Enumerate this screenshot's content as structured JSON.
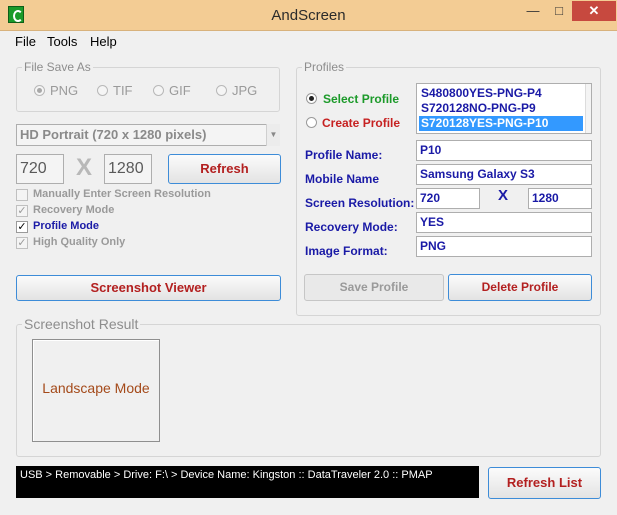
{
  "window": {
    "title": "AndScreen"
  },
  "menu": {
    "items": [
      "File",
      "Tools",
      "Help"
    ]
  },
  "file_save": {
    "label": "File Save As",
    "formats": [
      "PNG",
      "TIF",
      "GIF",
      "JPG"
    ],
    "selected": "PNG"
  },
  "resolution": {
    "preset": "HD Portrait (720 x 1280 pixels)",
    "width": "720",
    "x_sep": "X",
    "height": "1280",
    "refresh_label": "Refresh"
  },
  "options": {
    "manual": "Manually Enter Screen Resolution",
    "recovery": "Recovery Mode",
    "profile": "Profile Mode",
    "hq": "High Quality Only"
  },
  "screenshot_viewer_label": "Screenshot Viewer",
  "profiles": {
    "label": "Profiles",
    "select_label": "Select Profile",
    "create_label": "Create Profile",
    "list": [
      "S480800YES-PNG-P4",
      "S720128NO-PNG-P9",
      "S720128YES-PNG-P10"
    ],
    "selected_index": 2,
    "profile_name_label": "Profile Name:",
    "profile_name": "P10",
    "mobile_name_label": "Mobile Name",
    "mobile_name": "Samsung Galaxy S3",
    "screen_res_label": "Screen Resolution:",
    "res_w": "720",
    "res_x": "X",
    "res_h": "1280",
    "recovery_label": "Recovery Mode:",
    "recovery_value": "YES",
    "format_label": "Image Format:",
    "format_value": "PNG",
    "save_label": "Save Profile",
    "delete_label": "Delete Profile"
  },
  "result": {
    "label": "Screenshot Result",
    "preview_text": "Landscape Mode"
  },
  "status_text": "USB > Removable >  Drive: F:\\ >  Device Name: Kingston :: DataTraveler 2.0 :: PMAP",
  "refresh_list_label": "Refresh List"
}
